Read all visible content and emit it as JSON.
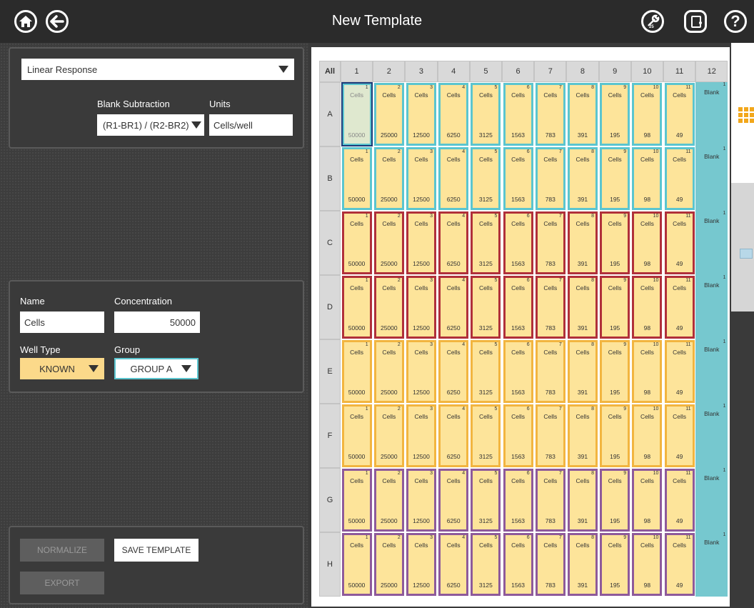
{
  "app": {
    "title": "New Template",
    "icons": [
      "home-icon",
      "back-icon",
      "tools-icon",
      "exit-door-icon",
      "help-icon"
    ],
    "tools_badge": "25"
  },
  "settings": {
    "analysis_type": "Linear Response",
    "blank_subtraction_label": "Blank Subtraction",
    "blank_subtraction_value": "(R1-BR1) / (R2-BR2)",
    "units_label": "Units",
    "units_value": "Cells/well"
  },
  "well_editor": {
    "name_label": "Name",
    "name_value": "Cells",
    "concentration_label": "Concentration",
    "concentration_value": "50000",
    "well_type_label": "Well Type",
    "well_type_value": "KNOWN",
    "group_label": "Group",
    "group_value": "GROUP A"
  },
  "actions": {
    "normalize": "NORMALIZE",
    "save_template": "SAVE TEMPLATE",
    "export": "EXPORT"
  },
  "plate": {
    "all_label": "All",
    "columns": [
      "1",
      "2",
      "3",
      "4",
      "5",
      "6",
      "7",
      "8",
      "9",
      "10",
      "11",
      "12"
    ],
    "rows": [
      "A",
      "B",
      "C",
      "D",
      "E",
      "F",
      "G",
      "H"
    ],
    "well_name": "Cells",
    "blank_name": "Blank",
    "concentrations": [
      "50000",
      "25000",
      "12500",
      "6250",
      "3125",
      "1563",
      "783",
      "391",
      "195",
      "98",
      "49"
    ],
    "blank_number": "1",
    "row_border_colors": {
      "A": "#5bc5cf",
      "B": "#5bc5cf",
      "C": "#b0303a",
      "D": "#b0303a",
      "E": "#f2b540",
      "F": "#f2b540",
      "G": "#8e5a9a",
      "H": "#8e5a9a"
    },
    "selected_well": "A1",
    "selected_fill": "#dfe8cf",
    "well_fill": "#fde49a",
    "blank_fill": "#76c8cf"
  },
  "colors": {
    "well_type_fill": "#fbd98a",
    "accent": "#5bc5cf"
  }
}
